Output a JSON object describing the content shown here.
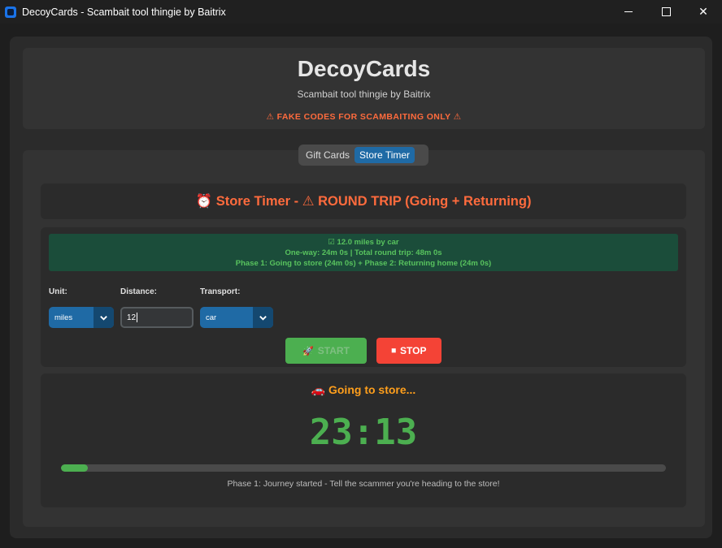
{
  "window": {
    "title": "DecoyCards - Scambait tool thingie by Baitrix"
  },
  "header": {
    "title": "DecoyCards",
    "subtitle": "Scambait tool thingie by Baitrix",
    "warning": "⚠ FAKE CODES FOR SCAMBAITING ONLY ⚠"
  },
  "tabs": [
    {
      "label": "Gift Cards",
      "active": false
    },
    {
      "label": "Store Timer",
      "active": true
    }
  ],
  "timer_header": {
    "icon": "alarm-clock-icon",
    "text": "⏰ Store Timer - ⚠ ROUND TRIP (Going + Returning)"
  },
  "info": {
    "line1": "☑ 12.0 miles by car",
    "line2": "One-way: 24m 0s | Total round trip: 48m 0s",
    "line3": "Phase 1: Going to store (24m 0s) + Phase 2: Returning home (24m 0s)"
  },
  "form": {
    "unit_label": "Unit:",
    "unit_value": "miles",
    "distance_label": "Distance:",
    "distance_value": "12",
    "transport_label": "Transport:",
    "transport_value": "car"
  },
  "buttons": {
    "start_icon": "🚀",
    "start_label": "START",
    "stop_icon": "⏹",
    "stop_label": "STOP"
  },
  "status": {
    "title": "🚗 Going to store...",
    "timer": "23:13",
    "progress": 0.045,
    "message": "Phase 1: Journey started - Tell the scammer you're heading to the store!"
  },
  "colors": {
    "accent_blue": "#1f6aa5",
    "warning_orange": "#ff6b3d",
    "status_orange": "#ff9f1c",
    "success_green": "#4caf50",
    "danger_red": "#f44336"
  }
}
